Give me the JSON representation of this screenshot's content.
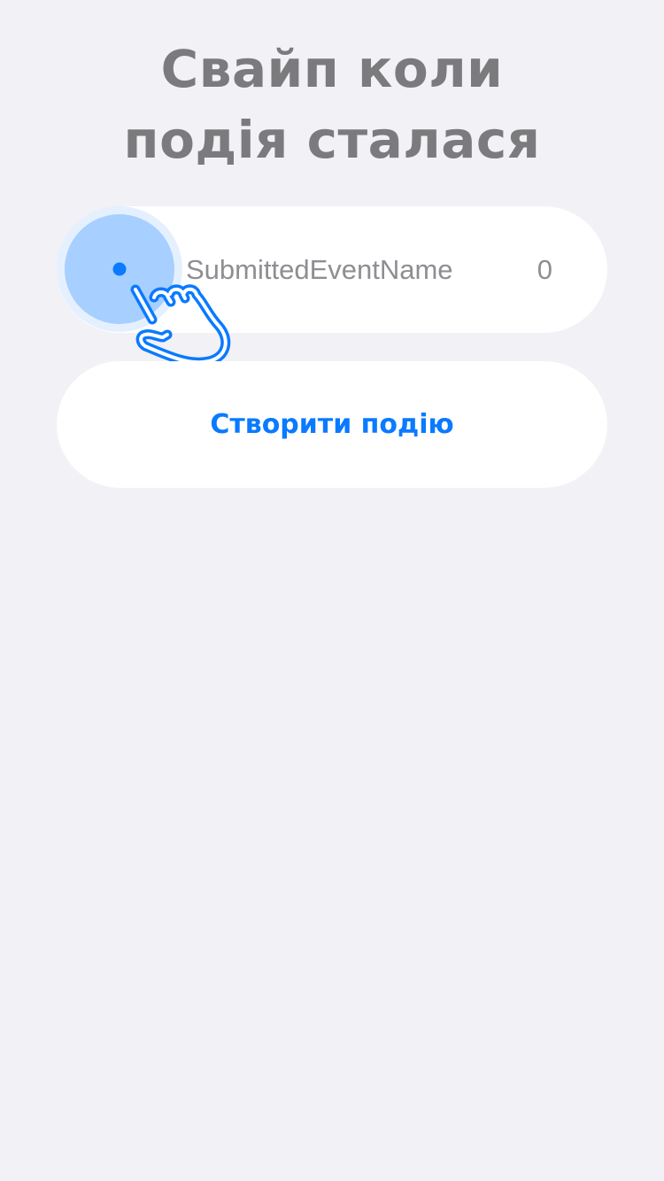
{
  "header": {
    "title_line1": "Свайп коли",
    "title_line2": "подія сталася"
  },
  "event": {
    "name": "SubmittedEventName",
    "count": "0"
  },
  "create_button": {
    "label": "Створити подію"
  },
  "hint": {
    "icon": "hand-pointer-icon"
  },
  "colors": {
    "background": "#f1f1f6",
    "accent": "#0a7aff",
    "title": "#7b7b7d",
    "secondary_text": "#8e8e93",
    "card": "#ffffff"
  }
}
